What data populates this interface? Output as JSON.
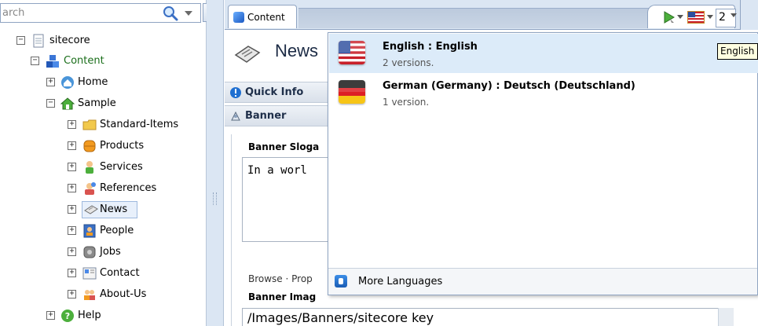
{
  "search": {
    "placeholder_text": "arch"
  },
  "tree": {
    "nodes": [
      {
        "label": "sitecore",
        "expander": "−",
        "icon": "document-icon"
      },
      {
        "label": "Content",
        "expander": "−",
        "icon": "content-cubes-icon"
      },
      {
        "label": "Home",
        "expander": "+",
        "icon": "home-icon"
      },
      {
        "label": "Sample",
        "expander": "−",
        "icon": "sample-house-icon"
      },
      {
        "label": "Standard-Items",
        "expander": "+",
        "icon": "folder-icon"
      },
      {
        "label": "Products",
        "expander": "+",
        "icon": "products-icon"
      },
      {
        "label": "Services",
        "expander": "+",
        "icon": "services-person-icon"
      },
      {
        "label": "References",
        "expander": "+",
        "icon": "references-icon"
      },
      {
        "label": "News",
        "expander": "+",
        "icon": "news-icon",
        "selected": true
      },
      {
        "label": "People",
        "expander": "+",
        "icon": "people-icon"
      },
      {
        "label": "Jobs",
        "expander": "+",
        "icon": "jobs-icon"
      },
      {
        "label": "Contact",
        "expander": "+",
        "icon": "contact-icon"
      },
      {
        "label": "About-Us",
        "expander": "+",
        "icon": "about-us-icon"
      },
      {
        "label": "Help",
        "expander": "+",
        "icon": "help-icon"
      }
    ]
  },
  "tabs": {
    "content_label": "Content",
    "version_number": "2"
  },
  "editor": {
    "item_title": "News",
    "quick_info_label": "Quick Info",
    "banner_section_label": "Banner",
    "banner_slogan_label": "Banner Sloga",
    "banner_slogan_value": "In a worl",
    "browse_links": "Browse · Prop",
    "banner_image_label": "Banner Imag",
    "banner_image_value": "/Images/Banners/sitecore key"
  },
  "language_menu": {
    "items": [
      {
        "name": "English : English",
        "versions": "2 versions.",
        "flag": "us-flag-icon"
      },
      {
        "name": "German (Germany) : Deutsch (Deutschland)",
        "versions": "1 version.",
        "flag": "german-flag-icon"
      }
    ],
    "more_label": "More Languages",
    "tooltip": "English"
  },
  "colors": {
    "panel_bg": "#dbe6f3",
    "selection_bg": "#dcebf9",
    "content_text_green": "#1a6e1a"
  }
}
